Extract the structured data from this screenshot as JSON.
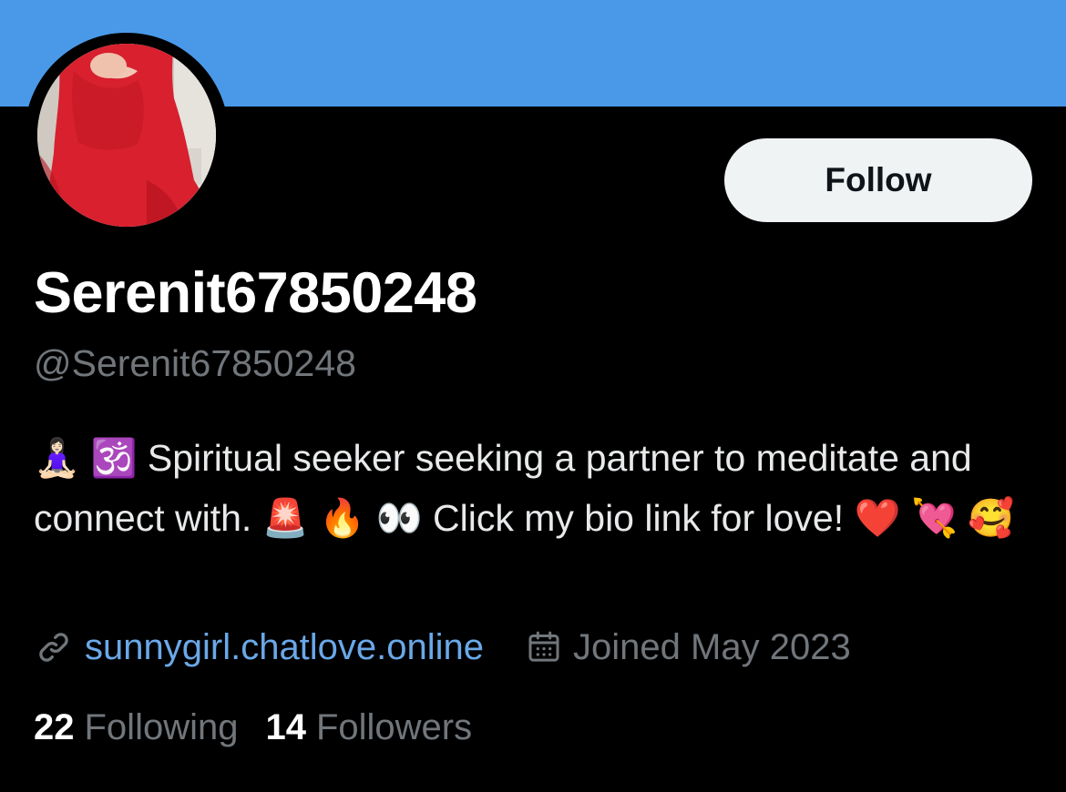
{
  "profile": {
    "display_name": "Serenit67850248",
    "handle": "@Serenit67850248",
    "bio": "🧘🏻‍♀️ 🕉️ Spiritual seeker seeking a partner to meditate and connect with. 🚨 🔥 👀 Click my bio link for love! ❤️ 💘 🥰",
    "website": "sunnygirl.chatlove.online",
    "joined": "Joined May 2023"
  },
  "actions": {
    "follow_label": "Follow"
  },
  "stats": {
    "following_count": "22",
    "following_label": "Following",
    "followers_count": "14",
    "followers_label": "Followers"
  },
  "icons": {
    "link": "link-icon",
    "calendar": "calendar-icon"
  },
  "colors": {
    "banner": "#4a99e9",
    "background": "#000000",
    "link": "#6aa8e8",
    "secondary_text": "#71767b",
    "follow_button_bg": "#eff3f4"
  }
}
